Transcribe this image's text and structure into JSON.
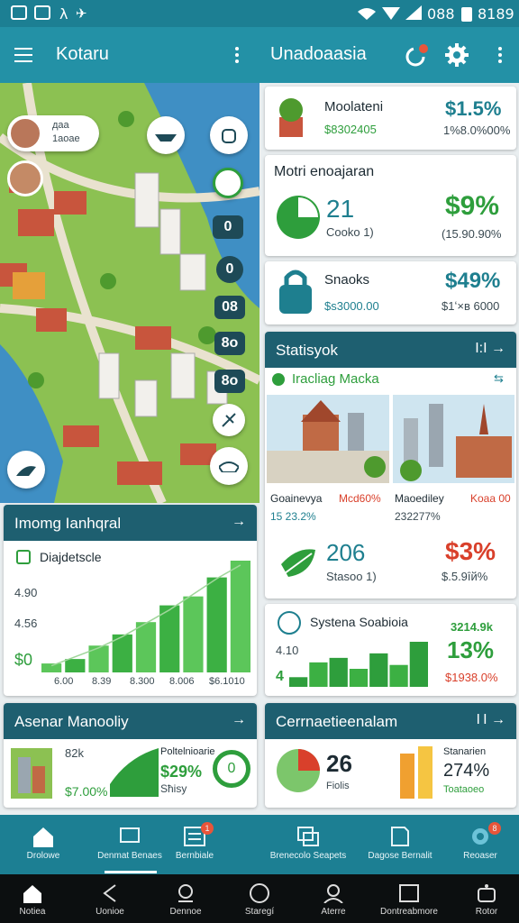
{
  "status_bar": {
    "left_text": "λ",
    "time_left": "088",
    "time_right": "8189"
  },
  "app_bar": {
    "title_left": "Kotaru",
    "title_right": "Unadoaasia"
  },
  "map": {
    "profile_1": {
      "line1": "даа",
      "line2": "1аоае"
    },
    "layer_labels": [
      "0",
      "0",
      "08",
      "8о",
      "8о"
    ]
  },
  "top_cards": [
    {
      "title": "Moolateni",
      "sub": "$8302405",
      "value": "$1.5%",
      "value_sub": "1%8.0%00%"
    },
    {
      "title": "Motri enoajaran",
      "big": "21",
      "big_sub": "Cooko 1)",
      "value": "$9%",
      "value_sub": "(15.90.90%"
    },
    {
      "title": "Snaoks",
      "sub": "$s3000.00",
      "value": "$49%",
      "value_sub": "$1ʻ×в 6000"
    }
  ],
  "stats_card": {
    "header": "Statisyok",
    "header_icon": "I:I",
    "subheader": "Iracliag Macka",
    "cities": [
      {
        "name": "Goainevya",
        "value": "15 23.2%",
        "tag": "Mcd60%"
      },
      {
        "name": "Maoediley",
        "value": "232277%",
        "tag": "Koaa 00"
      }
    ],
    "metric": {
      "big": "206",
      "sub": "Stasoo 1)",
      "value": "$3%",
      "value_sub": "$.5.9ȋй%"
    }
  },
  "chart_card": {
    "header": "Imomg Ianhqral",
    "legend": "Diajdetscle",
    "y_ticks": [
      "4.90",
      "4.56",
      "$0"
    ],
    "x_ticks": [
      "6.00",
      "8.39",
      "8.300",
      "8.006",
      "$6.1010"
    ]
  },
  "chart_data": {
    "type": "bar",
    "categories": [
      "6.00",
      "",
      "8.39",
      "",
      "8.300",
      "",
      "8.006",
      "",
      "$6.1010"
    ],
    "values": [
      8,
      12,
      24,
      34,
      45,
      60,
      68,
      85,
      100
    ],
    "trend": [
      6,
      14,
      22,
      32,
      44,
      56,
      70,
      84,
      96
    ]
  },
  "system_card": {
    "title": "Systena Soabioia",
    "y_label": "4.10",
    "x_label": "4",
    "values": [
      15,
      38,
      45,
      28,
      52,
      34,
      70
    ],
    "value_top": "3214.9k",
    "value": "13%",
    "value_sub": "$1938.0%"
  },
  "asset_card": {
    "header": "Asenar Manooliy",
    "stat1": "82k",
    "stat2": "$7.00%",
    "title": "Poltelnioarie",
    "value": "$29%",
    "sub": "Sħisy",
    "ring_label": "0"
  },
  "cement_card": {
    "header": "Cerrnaetieenalam",
    "header_icon": "I I",
    "big": "26",
    "big_sub": "Fiolis",
    "title": "Stanarien",
    "value": "274%",
    "sub": "Toataoeo"
  },
  "tabs": [
    {
      "label": "Drolowe",
      "icon": "home-icon"
    },
    {
      "label": "Denmat Benaes",
      "icon": "monitor-icon"
    },
    {
      "label": "Bernbiale",
      "icon": "list-icon"
    },
    {
      "label": "Brenecolo Seapets",
      "icon": "layers-icon"
    },
    {
      "label": "Dagose Bernalit",
      "icon": "document-icon"
    },
    {
      "label": "Reoaser",
      "icon": "gear-icon"
    }
  ],
  "tab_badges": [
    "1",
    "8"
  ],
  "system_nav": [
    {
      "label": "Notiea",
      "icon": "home-icon"
    },
    {
      "label": "Uonioe",
      "icon": "back-icon"
    },
    {
      "label": "Dennoe",
      "icon": "user-icon"
    },
    {
      "label": "Staregí",
      "icon": "circle-icon"
    },
    {
      "label": "Aterre",
      "icon": "person-icon"
    },
    {
      "label": "Dontreabmore",
      "icon": "window-icon"
    },
    {
      "label": "Rotor",
      "icon": "robot-icon"
    }
  ],
  "colors": {
    "primary": "#2391a6",
    "header": "#1e5f70",
    "green": "#2e9e3c",
    "red": "#d9402b"
  }
}
